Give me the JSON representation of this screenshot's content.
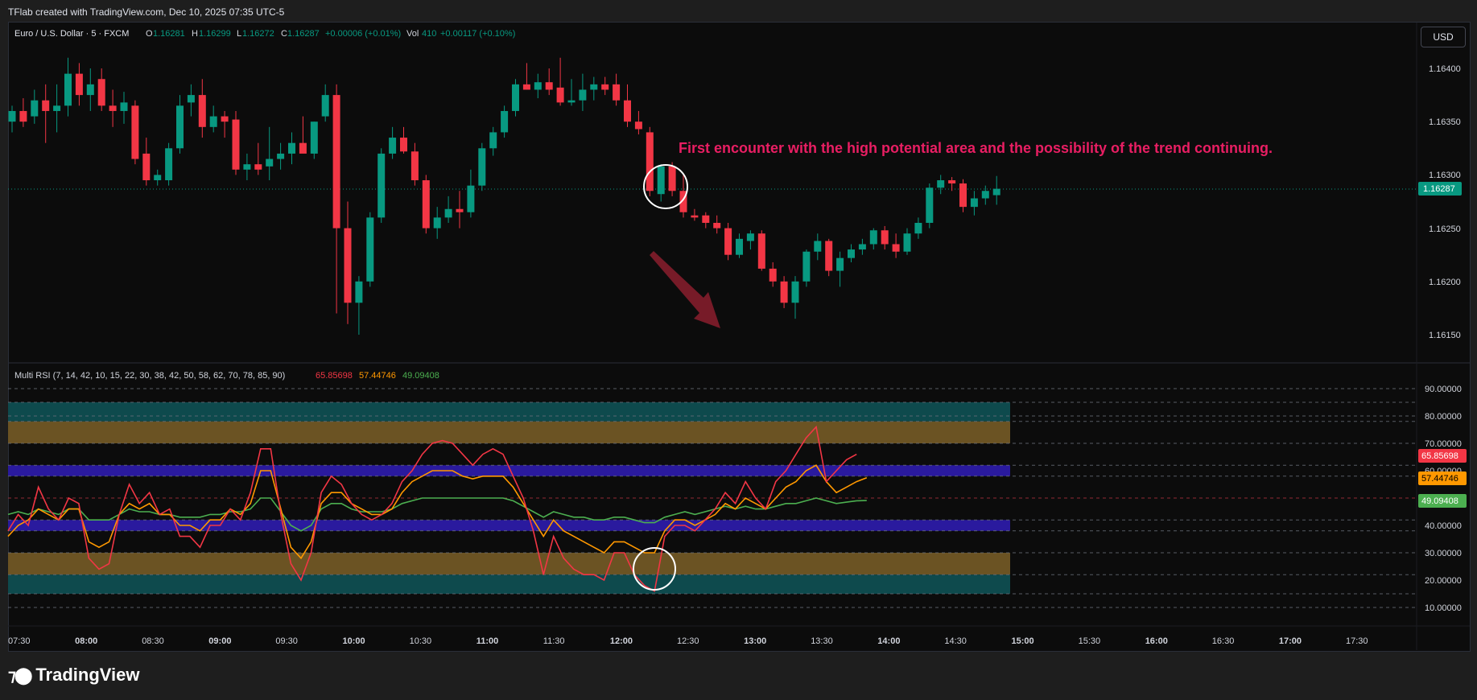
{
  "header": {
    "title": "TFlab created with TradingView.com, Dec 10, 2025 07:35 UTC-5"
  },
  "symbol": {
    "name": "Euro / U.S. Dollar · 5 · FXCM",
    "O_label": "O",
    "O": "1.16281",
    "H_label": "H",
    "H": "1.16299",
    "L_label": "L",
    "L": "1.16272",
    "C_label": "C",
    "C": "1.16287",
    "change": "+0.00006 (+0.01%)",
    "vol_label": "Vol",
    "vol": "410",
    "vol_change": "+0.00117 (+0.10%)"
  },
  "currency_button": "USD",
  "annotation": {
    "text": "First encounter with the high potential area and the possibility of the trend continuing.",
    "color": "#e91e63"
  },
  "price_axis": {
    "ticks": [
      "1.16400",
      "1.16350",
      "1.16300",
      "1.16250",
      "1.16200",
      "1.16150"
    ],
    "current_price": "1.16287"
  },
  "indicator": {
    "name": "Multi RSI (7, 14, 42, 10, 15, 22, 30, 38, 42, 50, 58, 62, 70, 78, 85, 90)",
    "values": [
      {
        "value": "65.85698",
        "color": "#f23645"
      },
      {
        "value": "57.44746",
        "color": "#ff9800"
      },
      {
        "value": "49.09408",
        "color": "#4caf50"
      }
    ],
    "axis_ticks": [
      "90.00000",
      "80.00000",
      "70.00000",
      "60.00000",
      "40.00000",
      "30.00000",
      "20.00000",
      "10.00000"
    ]
  },
  "time_axis": {
    "labels": [
      "07:30",
      "08:00",
      "08:30",
      "09:00",
      "09:30",
      "10:00",
      "10:30",
      "11:00",
      "11:30",
      "12:00",
      "12:30",
      "13:00",
      "13:30",
      "14:00",
      "14:30",
      "15:00",
      "15:30",
      "16:00",
      "16:30",
      "17:00",
      "17:30"
    ]
  },
  "footer": {
    "brand": "TradingView"
  },
  "colors": {
    "up": "#089981",
    "down": "#f23645",
    "rsi_fast": "#f23645",
    "rsi_mid": "#ff9800",
    "rsi_slow": "#4caf50",
    "zone_teal": "#0e4a4d",
    "zone_gold": "#6b5323",
    "zone_purple": "#2a1a9e"
  },
  "chart_data": {
    "type": "candlestick",
    "y_range": [
      1.1612,
      1.1643
    ],
    "candles": [
      {
        "o": 1.1635,
        "h": 1.16365,
        "l": 1.1634,
        "c": 1.1636
      },
      {
        "o": 1.1636,
        "h": 1.16372,
        "l": 1.16345,
        "c": 1.1635
      },
      {
        "o": 1.16355,
        "h": 1.1638,
        "l": 1.16348,
        "c": 1.1637
      },
      {
        "o": 1.1637,
        "h": 1.16385,
        "l": 1.1633,
        "c": 1.1636
      },
      {
        "o": 1.1636,
        "h": 1.16385,
        "l": 1.1634,
        "c": 1.16365
      },
      {
        "o": 1.16365,
        "h": 1.1641,
        "l": 1.16355,
        "c": 1.16395
      },
      {
        "o": 1.16395,
        "h": 1.16405,
        "l": 1.16365,
        "c": 1.16375
      },
      {
        "o": 1.16375,
        "h": 1.164,
        "l": 1.1636,
        "c": 1.16385
      },
      {
        "o": 1.1639,
        "h": 1.164,
        "l": 1.1636,
        "c": 1.16365
      },
      {
        "o": 1.16365,
        "h": 1.1638,
        "l": 1.16345,
        "c": 1.1636
      },
      {
        "o": 1.1636,
        "h": 1.16378,
        "l": 1.16348,
        "c": 1.16368
      },
      {
        "o": 1.16365,
        "h": 1.1637,
        "l": 1.1631,
        "c": 1.16315
      },
      {
        "o": 1.1632,
        "h": 1.16335,
        "l": 1.1629,
        "c": 1.16295
      },
      {
        "o": 1.16295,
        "h": 1.16305,
        "l": 1.1629,
        "c": 1.163
      },
      {
        "o": 1.16295,
        "h": 1.1633,
        "l": 1.1629,
        "c": 1.16325
      },
      {
        "o": 1.16325,
        "h": 1.16375,
        "l": 1.1632,
        "c": 1.16365
      },
      {
        "o": 1.16368,
        "h": 1.16385,
        "l": 1.16355,
        "c": 1.16375
      },
      {
        "o": 1.16375,
        "h": 1.1639,
        "l": 1.16335,
        "c": 1.16345
      },
      {
        "o": 1.16345,
        "h": 1.16365,
        "l": 1.1634,
        "c": 1.16355
      },
      {
        "o": 1.16355,
        "h": 1.1636,
        "l": 1.16335,
        "c": 1.1635
      },
      {
        "o": 1.16352,
        "h": 1.1636,
        "l": 1.163,
        "c": 1.16305
      },
      {
        "o": 1.16305,
        "h": 1.1632,
        "l": 1.16295,
        "c": 1.1631
      },
      {
        "o": 1.1631,
        "h": 1.1633,
        "l": 1.163,
        "c": 1.16305
      },
      {
        "o": 1.16308,
        "h": 1.16345,
        "l": 1.16295,
        "c": 1.16315
      },
      {
        "o": 1.16315,
        "h": 1.1633,
        "l": 1.16305,
        "c": 1.1632
      },
      {
        "o": 1.1632,
        "h": 1.1634,
        "l": 1.1631,
        "c": 1.1633
      },
      {
        "o": 1.1633,
        "h": 1.16355,
        "l": 1.16325,
        "c": 1.1632
      },
      {
        "o": 1.1632,
        "h": 1.1635,
        "l": 1.16315,
        "c": 1.1635
      },
      {
        "o": 1.16355,
        "h": 1.16385,
        "l": 1.1635,
        "c": 1.16375
      },
      {
        "o": 1.16375,
        "h": 1.16385,
        "l": 1.1617,
        "c": 1.1625
      },
      {
        "o": 1.1625,
        "h": 1.16275,
        "l": 1.1616,
        "c": 1.1618
      },
      {
        "o": 1.1618,
        "h": 1.16205,
        "l": 1.1615,
        "c": 1.162
      },
      {
        "o": 1.162,
        "h": 1.16265,
        "l": 1.16195,
        "c": 1.1626
      },
      {
        "o": 1.1626,
        "h": 1.16325,
        "l": 1.16255,
        "c": 1.1632
      },
      {
        "o": 1.1632,
        "h": 1.16345,
        "l": 1.16315,
        "c": 1.16335
      },
      {
        "o": 1.16335,
        "h": 1.16345,
        "l": 1.1632,
        "c": 1.16322
      },
      {
        "o": 1.16322,
        "h": 1.1633,
        "l": 1.1629,
        "c": 1.16295
      },
      {
        "o": 1.16295,
        "h": 1.163,
        "l": 1.16245,
        "c": 1.1625
      },
      {
        "o": 1.1625,
        "h": 1.1627,
        "l": 1.1624,
        "c": 1.1626
      },
      {
        "o": 1.1626,
        "h": 1.1628,
        "l": 1.16255,
        "c": 1.16268
      },
      {
        "o": 1.16268,
        "h": 1.16285,
        "l": 1.1625,
        "c": 1.16265
      },
      {
        "o": 1.16265,
        "h": 1.16305,
        "l": 1.1626,
        "c": 1.1629
      },
      {
        "o": 1.1629,
        "h": 1.1633,
        "l": 1.16285,
        "c": 1.16325
      },
      {
        "o": 1.16325,
        "h": 1.16345,
        "l": 1.16318,
        "c": 1.1634
      },
      {
        "o": 1.1634,
        "h": 1.16365,
        "l": 1.16335,
        "c": 1.1636
      },
      {
        "o": 1.1636,
        "h": 1.1639,
        "l": 1.16355,
        "c": 1.16385
      },
      {
        "o": 1.16385,
        "h": 1.16405,
        "l": 1.1638,
        "c": 1.1638
      },
      {
        "o": 1.1638,
        "h": 1.16395,
        "l": 1.16372,
        "c": 1.16387
      },
      {
        "o": 1.16387,
        "h": 1.164,
        "l": 1.16375,
        "c": 1.1638
      },
      {
        "o": 1.16382,
        "h": 1.1641,
        "l": 1.16365,
        "c": 1.16368
      },
      {
        "o": 1.16368,
        "h": 1.1639,
        "l": 1.16365,
        "c": 1.1637
      },
      {
        "o": 1.1637,
        "h": 1.16395,
        "l": 1.1636,
        "c": 1.1638
      },
      {
        "o": 1.1638,
        "h": 1.16392,
        "l": 1.1637,
        "c": 1.16385
      },
      {
        "o": 1.16385,
        "h": 1.16392,
        "l": 1.16375,
        "c": 1.1638
      },
      {
        "o": 1.16385,
        "h": 1.16395,
        "l": 1.16365,
        "c": 1.1637
      },
      {
        "o": 1.1637,
        "h": 1.16385,
        "l": 1.16345,
        "c": 1.1635
      },
      {
        "o": 1.1635,
        "h": 1.1636,
        "l": 1.16338,
        "c": 1.16343
      },
      {
        "o": 1.1634,
        "h": 1.16345,
        "l": 1.1628,
        "c": 1.16285
      },
      {
        "o": 1.16282,
        "h": 1.1631,
        "l": 1.16275,
        "c": 1.16308
      },
      {
        "o": 1.16308,
        "h": 1.16312,
        "l": 1.1628,
        "c": 1.16285
      },
      {
        "o": 1.16285,
        "h": 1.163,
        "l": 1.1626,
        "c": 1.16265
      },
      {
        "o": 1.16262,
        "h": 1.16268,
        "l": 1.16257,
        "c": 1.1626
      },
      {
        "o": 1.16262,
        "h": 1.16265,
        "l": 1.1625,
        "c": 1.16255
      },
      {
        "o": 1.16255,
        "h": 1.16262,
        "l": 1.16245,
        "c": 1.1625
      },
      {
        "o": 1.1625,
        "h": 1.16255,
        "l": 1.1622,
        "c": 1.16225
      },
      {
        "o": 1.16225,
        "h": 1.16245,
        "l": 1.16222,
        "c": 1.1624
      },
      {
        "o": 1.16238,
        "h": 1.16248,
        "l": 1.1623,
        "c": 1.16245
      },
      {
        "o": 1.16245,
        "h": 1.16248,
        "l": 1.1621,
        "c": 1.16212
      },
      {
        "o": 1.16212,
        "h": 1.16218,
        "l": 1.16195,
        "c": 1.162
      },
      {
        "o": 1.162,
        "h": 1.16205,
        "l": 1.16175,
        "c": 1.1618
      },
      {
        "o": 1.1618,
        "h": 1.16205,
        "l": 1.16165,
        "c": 1.162
      },
      {
        "o": 1.162,
        "h": 1.1623,
        "l": 1.16195,
        "c": 1.16228
      },
      {
        "o": 1.16228,
        "h": 1.16245,
        "l": 1.1622,
        "c": 1.16238
      },
      {
        "o": 1.16238,
        "h": 1.1624,
        "l": 1.16205,
        "c": 1.1621
      },
      {
        "o": 1.1621,
        "h": 1.16228,
        "l": 1.16195,
        "c": 1.16222
      },
      {
        "o": 1.16222,
        "h": 1.16235,
        "l": 1.16218,
        "c": 1.1623
      },
      {
        "o": 1.1623,
        "h": 1.1624,
        "l": 1.16225,
        "c": 1.16235
      },
      {
        "o": 1.16235,
        "h": 1.1625,
        "l": 1.1623,
        "c": 1.16248
      },
      {
        "o": 1.16248,
        "h": 1.16252,
        "l": 1.1623,
        "c": 1.16235
      },
      {
        "o": 1.16235,
        "h": 1.16245,
        "l": 1.16222,
        "c": 1.16228
      },
      {
        "o": 1.16228,
        "h": 1.1625,
        "l": 1.16225,
        "c": 1.16245
      },
      {
        "o": 1.16245,
        "h": 1.1626,
        "l": 1.1624,
        "c": 1.16255
      },
      {
        "o": 1.16255,
        "h": 1.16292,
        "l": 1.1625,
        "c": 1.16288
      },
      {
        "o": 1.16288,
        "h": 1.163,
        "l": 1.16282,
        "c": 1.16295
      },
      {
        "o": 1.16295,
        "h": 1.16298,
        "l": 1.16285,
        "c": 1.16292
      },
      {
        "o": 1.16292,
        "h": 1.16296,
        "l": 1.16265,
        "c": 1.1627
      },
      {
        "o": 1.1627,
        "h": 1.16285,
        "l": 1.16262,
        "c": 1.16278
      },
      {
        "o": 1.16278,
        "h": 1.1629,
        "l": 1.16272,
        "c": 1.16285
      },
      {
        "o": 1.16281,
        "h": 1.16299,
        "l": 1.16272,
        "c": 1.16287
      }
    ],
    "rsi_y_range": [
      0,
      95
    ],
    "rsi_bands": [
      {
        "from": 78,
        "to": 85,
        "color": "#0e4a4d"
      },
      {
        "from": 70,
        "to": 78,
        "color": "#6b5323"
      },
      {
        "from": 58,
        "to": 62,
        "color": "#2a1a9e"
      },
      {
        "from": 38,
        "to": 42,
        "color": "#2a1a9e"
      },
      {
        "from": 22,
        "to": 30,
        "color": "#6b5323"
      },
      {
        "from": 15,
        "to": 22,
        "color": "#0e4a4d"
      }
    ],
    "rsi_series": [
      {
        "values": [
          38,
          44,
          40,
          54,
          46,
          42,
          50,
          48,
          28,
          24,
          26,
          44,
          55,
          48,
          52,
          44,
          46,
          36,
          36,
          32,
          40,
          40,
          46,
          42,
          52,
          68,
          68,
          44,
          26,
          20,
          30,
          52,
          58,
          55,
          48,
          44,
          42,
          44,
          48,
          56,
          60,
          66,
          70,
          71,
          70,
          66,
          62,
          66,
          68,
          66,
          58,
          50,
          38,
          22,
          36,
          28,
          24,
          22,
          22,
          20,
          30,
          30,
          22,
          18,
          16,
          36,
          40,
          40,
          38,
          42,
          46,
          52,
          48,
          56,
          50,
          46,
          56,
          60,
          66,
          72,
          76,
          56,
          60,
          64,
          66
        ]
      },
      {
        "values": [
          36,
          40,
          42,
          46,
          44,
          42,
          46,
          46,
          34,
          32,
          34,
          44,
          48,
          46,
          48,
          44,
          44,
          40,
          40,
          38,
          42,
          42,
          46,
          44,
          48,
          60,
          60,
          46,
          32,
          28,
          34,
          48,
          52,
          52,
          48,
          46,
          44,
          44,
          46,
          52,
          56,
          58,
          60,
          60,
          60,
          58,
          57,
          58,
          58,
          58,
          54,
          48,
          42,
          36,
          42,
          38,
          36,
          34,
          32,
          30,
          34,
          34,
          32,
          30,
          30,
          38,
          42,
          42,
          40,
          42,
          44,
          48,
          46,
          50,
          48,
          46,
          50,
          54,
          56,
          60,
          62,
          56,
          52,
          54,
          56,
          57.4
        ]
      },
      {
        "values": [
          44,
          45,
          44,
          46,
          45,
          44,
          46,
          46,
          42,
          42,
          42,
          44,
          46,
          45,
          45,
          44,
          44,
          43,
          43,
          43,
          44,
          44,
          45,
          45,
          46,
          50,
          50,
          45,
          40,
          38,
          40,
          46,
          48,
          48,
          46,
          45,
          45,
          45,
          46,
          48,
          49,
          50,
          50,
          50,
          50,
          50,
          50,
          50,
          50,
          50,
          49,
          47,
          45,
          43,
          45,
          44,
          43,
          43,
          42,
          42,
          43,
          43,
          42,
          41,
          41,
          43,
          44,
          45,
          44,
          45,
          46,
          47,
          46,
          47,
          46,
          46,
          47,
          48,
          48,
          49,
          50,
          49,
          48,
          48.5,
          49,
          49.1
        ]
      }
    ]
  }
}
